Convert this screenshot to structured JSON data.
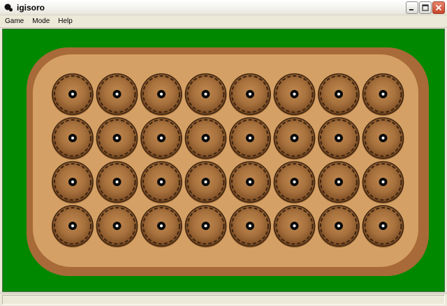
{
  "window": {
    "title": "igisoro"
  },
  "menu": [
    {
      "label": "Game"
    },
    {
      "label": "Mode"
    },
    {
      "label": "Help"
    }
  ],
  "colors": {
    "table_green": "#008800",
    "board_rim": "#a86a38",
    "board_surface": "#d4a065",
    "pit_fill": "#a5703d",
    "pit_edge": "#3d2410"
  },
  "board": {
    "rows": 4,
    "columns": 8,
    "seeds_per_pit": [
      [
        1,
        1,
        1,
        1,
        1,
        1,
        1,
        1
      ],
      [
        1,
        1,
        1,
        1,
        1,
        1,
        1,
        1
      ],
      [
        1,
        1,
        1,
        1,
        1,
        1,
        1,
        1
      ],
      [
        1,
        1,
        1,
        1,
        1,
        1,
        1,
        1
      ]
    ]
  },
  "status": {
    "text": ""
  }
}
